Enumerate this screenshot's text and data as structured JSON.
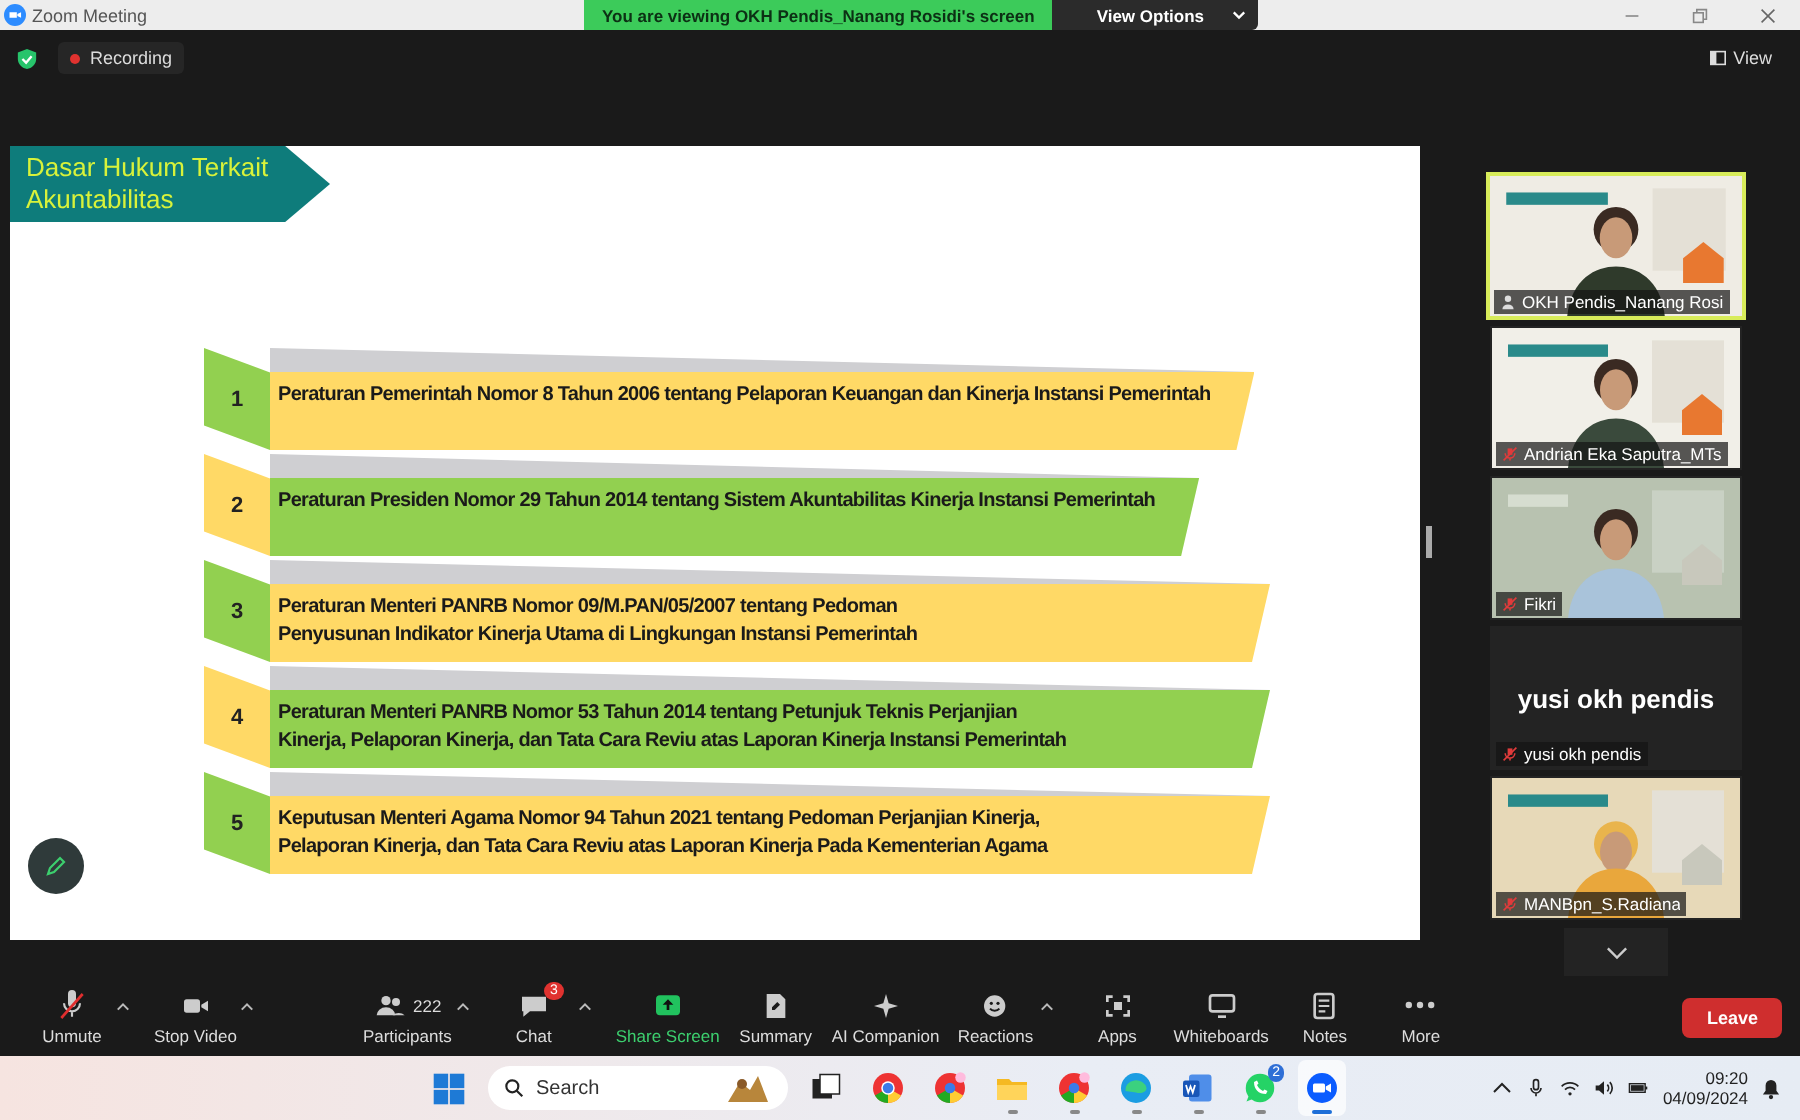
{
  "title_bar": {
    "app_title": "Zoom Meeting",
    "viewing_banner": "You are viewing OKH Pendis_Nanang Rosidi's screen",
    "view_options": "View Options"
  },
  "meeting_bar": {
    "recording": "Recording",
    "view": "View"
  },
  "slide": {
    "title": "Dasar Hukum Terkait Akuntabilitas",
    "items": [
      {
        "number": "1",
        "text": "Peraturan Pemerintah Nomor 8 Tahun 2006 tentang Pelaporan Keuangan dan Kinerja Instansi Pemerintah",
        "color": "#ffd966"
      },
      {
        "number": "2",
        "text": "Peraturan Presiden Nomor 29 Tahun 2014 tentang Sistem Akuntabilitas Kinerja Instansi Pemerintah",
        "color": "#92d050"
      },
      {
        "number": "3",
        "text": "Peraturan Menteri PANRB Nomor 09/M.PAN/05/2007 tentang Pedoman Penyusunan Indikator Kinerja Utama di Lingkungan Instansi Pemerintah",
        "color": "#ffd966"
      },
      {
        "number": "4",
        "text": "Peraturan Menteri PANRB Nomor 53 Tahun 2014 tentang Petunjuk Teknis Perjanjian Kinerja, Pelaporan Kinerja, dan Tata Cara Reviu atas Laporan Kinerja Instansi Pemerintah",
        "color": "#92d050"
      },
      {
        "number": "5",
        "text": "Keputusan Menteri Agama Nomor 94 Tahun 2021 tentang Pedoman Perjanjian Kinerja, Pelaporan Kinerja, dan Tata Cara Reviu atas Laporan Kinerja Pada Kementerian Agama",
        "color": "#ffd966"
      }
    ]
  },
  "gallery": {
    "tiles": [
      {
        "kind": "video",
        "name": "OKH Pendis_Nanang Rosi",
        "muted": false,
        "speaking": true
      },
      {
        "kind": "video",
        "name": "Andrian Eka Saputra_MTs",
        "muted": true,
        "speaking": false
      },
      {
        "kind": "video",
        "name": "Fikri",
        "muted": true,
        "speaking": false
      },
      {
        "kind": "name_card",
        "display_name": "yusi okh pendis",
        "name": "yusi okh pendis",
        "muted": true,
        "speaking": false
      },
      {
        "kind": "video",
        "name": "MANBpn_S.Radiana",
        "muted": true,
        "speaking": false
      }
    ]
  },
  "toolbar": {
    "buttons": [
      {
        "kind": "mic",
        "label": "Unmute",
        "muted": true,
        "menu": true
      },
      {
        "kind": "camera",
        "label": "Stop Video",
        "menu": true
      },
      {
        "kind": "participants",
        "label": "Participants",
        "count": "222",
        "menu": true
      },
      {
        "kind": "chat",
        "label": "Chat",
        "badge": "3",
        "menu": true
      },
      {
        "kind": "share",
        "label": "Share Screen",
        "menu": false
      },
      {
        "kind": "summary",
        "label": "Summary",
        "menu": false
      },
      {
        "kind": "ai",
        "label": "AI Companion",
        "menu": false
      },
      {
        "kind": "reactions",
        "label": "Reactions",
        "menu": true
      },
      {
        "kind": "apps",
        "label": "Apps",
        "menu": false
      },
      {
        "kind": "whiteboards",
        "label": "Whiteboards",
        "menu": false
      },
      {
        "kind": "notes",
        "label": "Notes",
        "menu": false
      },
      {
        "kind": "more",
        "label": "More",
        "menu": false
      }
    ],
    "leave": "Leave"
  },
  "taskbar": {
    "search_placeholder": "Search",
    "apps": [
      {
        "kind": "task_view",
        "running": false,
        "selected": false
      },
      {
        "kind": "browser",
        "running": false,
        "selected": false
      },
      {
        "kind": "browser_profile",
        "running": false,
        "selected": false
      },
      {
        "kind": "folder",
        "running": true,
        "selected": false
      },
      {
        "kind": "browser_profile",
        "running": true,
        "selected": false
      },
      {
        "kind": "browser_wave",
        "running": true,
        "selected": false
      },
      {
        "kind": "document",
        "running": true,
        "selected": false
      },
      {
        "kind": "messenger",
        "running": true,
        "selected": false,
        "badge": "2"
      },
      {
        "kind": "video",
        "running": true,
        "selected": true
      }
    ],
    "time": "09:20",
    "date": "04/09/2024"
  }
}
